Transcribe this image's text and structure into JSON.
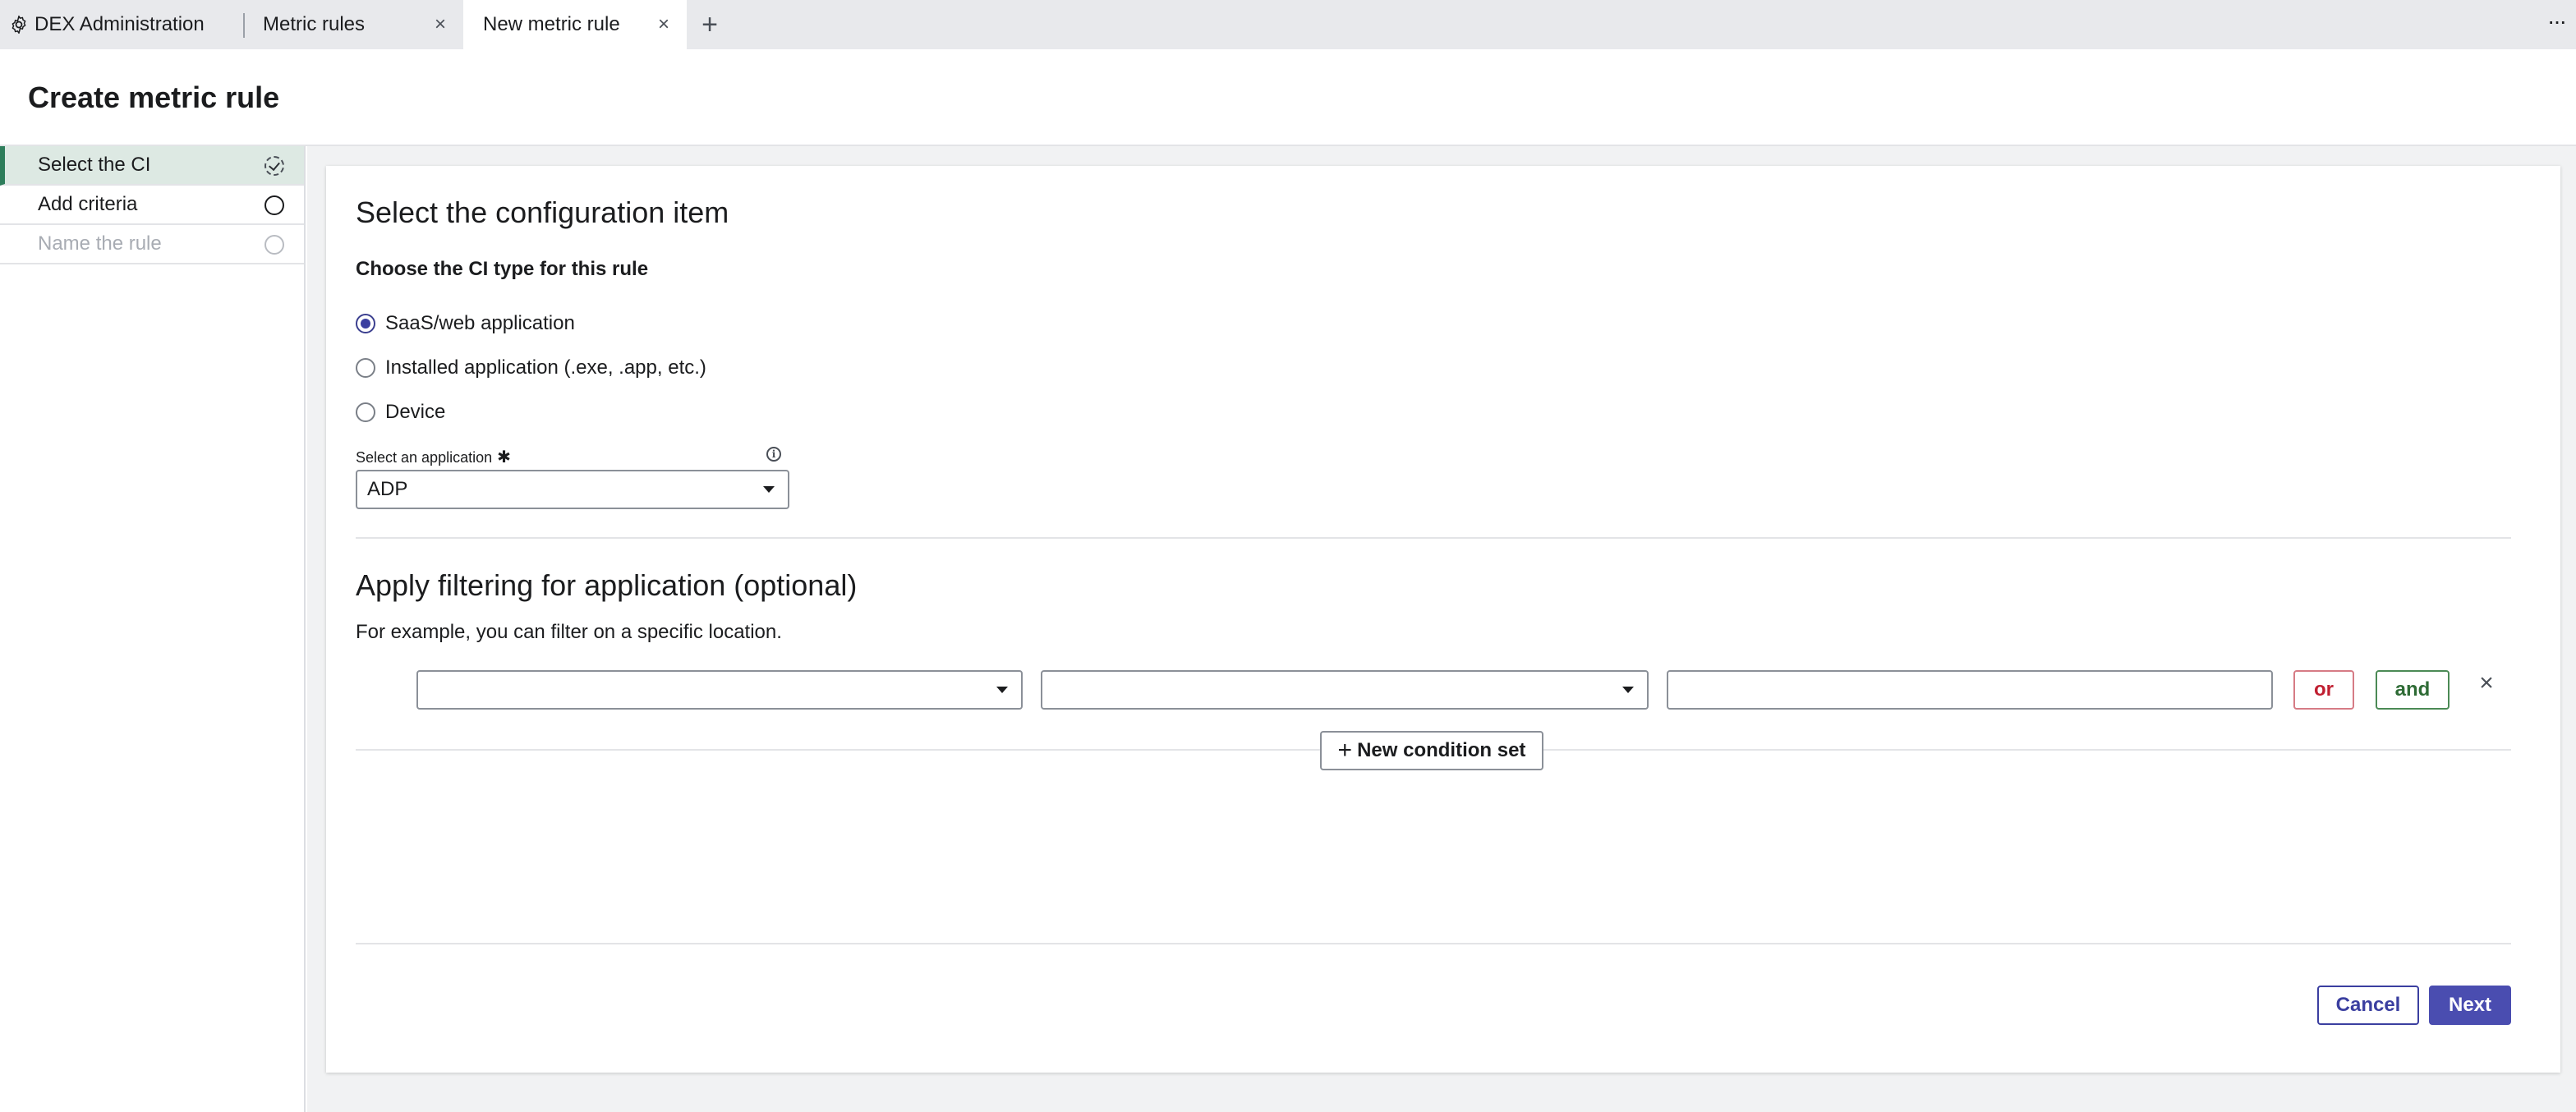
{
  "tabs": [
    {
      "label": "DEX Administration",
      "icon": "gear-icon",
      "active": false
    },
    {
      "label": "Metric rules",
      "active": false,
      "closable": true
    },
    {
      "label": "New metric rule",
      "active": true,
      "closable": true
    }
  ],
  "tab_close_glyph": "×",
  "tab_add_glyph": "+",
  "more_glyph": "···",
  "page": {
    "title": "Create metric rule"
  },
  "steps": [
    {
      "label": "Select the CI",
      "state": "active"
    },
    {
      "label": "Add criteria",
      "state": "pending"
    },
    {
      "label": "Name the rule",
      "state": "disabled"
    }
  ],
  "ci_section": {
    "heading": "Select the configuration item",
    "subheading": "Choose the CI type for this rule",
    "options": [
      {
        "label": "SaaS/web application",
        "checked": true
      },
      {
        "label": "Installed application (.exe, .app, etc.)",
        "checked": false
      },
      {
        "label": "Device",
        "checked": false
      }
    ],
    "app_select": {
      "label": "Select an application",
      "required_mark": "✱",
      "info_glyph": "i",
      "value": "ADP"
    }
  },
  "filter_section": {
    "heading": "Apply filtering for application (optional)",
    "helper": "For example, you can filter on a specific location.",
    "condition": {
      "field": "",
      "operator": "",
      "value": ""
    },
    "or_label": "or",
    "and_label": "and",
    "remove_glyph": "×",
    "new_condition_plus": "+",
    "new_condition_label": "New condition set"
  },
  "footer": {
    "cancel_label": "Cancel",
    "next_label": "Next"
  },
  "colors": {
    "accent": "#4a4db0",
    "active_step_bg": "#dde9e3",
    "active_step_bar": "#2e7d5b",
    "or_red": "#c01f31",
    "and_green": "#2e6b35"
  }
}
